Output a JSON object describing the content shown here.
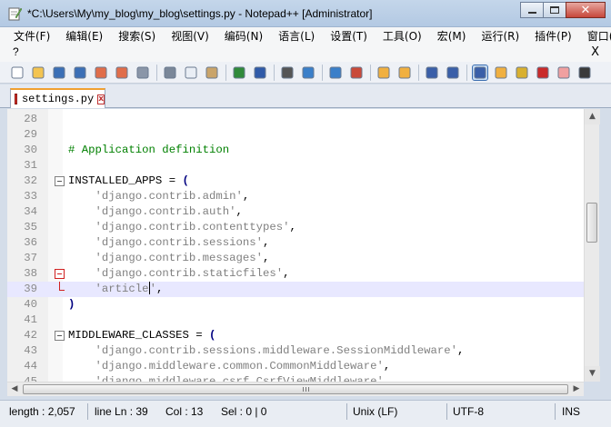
{
  "window": {
    "title": "*C:\\Users\\My\\my_blog\\my_blog\\settings.py - Notepad++ [Administrator]"
  },
  "menu": [
    {
      "label": "文件(F)"
    },
    {
      "label": "编辑(E)"
    },
    {
      "label": "搜索(S)"
    },
    {
      "label": "视图(V)"
    },
    {
      "label": "编码(N)"
    },
    {
      "label": "语言(L)"
    },
    {
      "label": "设置(T)"
    },
    {
      "label": "工具(O)"
    },
    {
      "label": "宏(M)"
    },
    {
      "label": "运行(R)"
    },
    {
      "label": "插件(P)"
    },
    {
      "label": "窗口(W)"
    }
  ],
  "menu_help": "?",
  "menu_close": "X",
  "toolbar": {
    "icons": [
      "new-file-icon",
      "open-file-icon",
      "save-icon",
      "save-all-icon",
      "close-icon",
      "close-all-icon",
      "print-icon",
      "cut-icon",
      "copy-icon",
      "paste-icon",
      "undo-icon",
      "redo-icon",
      "find-icon",
      "replace-icon",
      "zoom-in-icon",
      "zoom-out-icon",
      "sync-vertical-icon",
      "sync-horizontal-icon",
      "word-wrap-icon",
      "show-all-chars-icon",
      "indent-guide-icon",
      "doc-map-icon",
      "function-list-icon",
      "record-macro-icon",
      "folder-icon",
      "run-macro-icon"
    ]
  },
  "tab": {
    "label": "settings.py",
    "close": "x"
  },
  "editor": {
    "current_line": 39,
    "lines": [
      {
        "n": "28",
        "text": ""
      },
      {
        "n": "29",
        "text": ""
      },
      {
        "n": "30",
        "text": "# Application definition",
        "kind": "comment"
      },
      {
        "n": "31",
        "text": ""
      },
      {
        "n": "32",
        "text": "INSTALLED_APPS = ",
        "op": "(",
        "fold": "open"
      },
      {
        "n": "33",
        "indent": "    ",
        "str": "'django.contrib.admin'",
        "tail": ","
      },
      {
        "n": "34",
        "indent": "    ",
        "str": "'django.contrib.auth'",
        "tail": ","
      },
      {
        "n": "35",
        "indent": "    ",
        "str": "'django.contrib.contenttypes'",
        "tail": ","
      },
      {
        "n": "36",
        "indent": "    ",
        "str": "'django.contrib.sessions'",
        "tail": ","
      },
      {
        "n": "37",
        "indent": "    ",
        "str": "'django.contrib.messages'",
        "tail": ","
      },
      {
        "n": "38",
        "indent": "    ",
        "str": "'django.contrib.staticfiles'",
        "tail": ",",
        "fold": "red"
      },
      {
        "n": "39",
        "indent": "    ",
        "str": "'article",
        "after_caret": "'",
        "tail": ",",
        "caret": true,
        "fold": "end"
      },
      {
        "n": "40",
        "text": "",
        "op": ")"
      },
      {
        "n": "41",
        "text": ""
      },
      {
        "n": "42",
        "text": "MIDDLEWARE_CLASSES = ",
        "op": "(",
        "fold": "open"
      },
      {
        "n": "43",
        "indent": "    ",
        "str": "'django.contrib.sessions.middleware.SessionMiddleware'",
        "tail": ","
      },
      {
        "n": "44",
        "indent": "    ",
        "str": "'django.middleware.common.CommonMiddleware'",
        "tail": ","
      },
      {
        "n": "45",
        "indent": "    ",
        "str": "'django.middleware.csrf.CsrfViewMiddleware'",
        "tail": ","
      }
    ]
  },
  "status": {
    "length": "length : 2,057",
    "line": "line Ln : 39",
    "col": "Col : 13",
    "sel": "Sel : 0 | 0",
    "eol": "Unix (LF)",
    "encoding": "UTF-8",
    "mode": "INS"
  }
}
